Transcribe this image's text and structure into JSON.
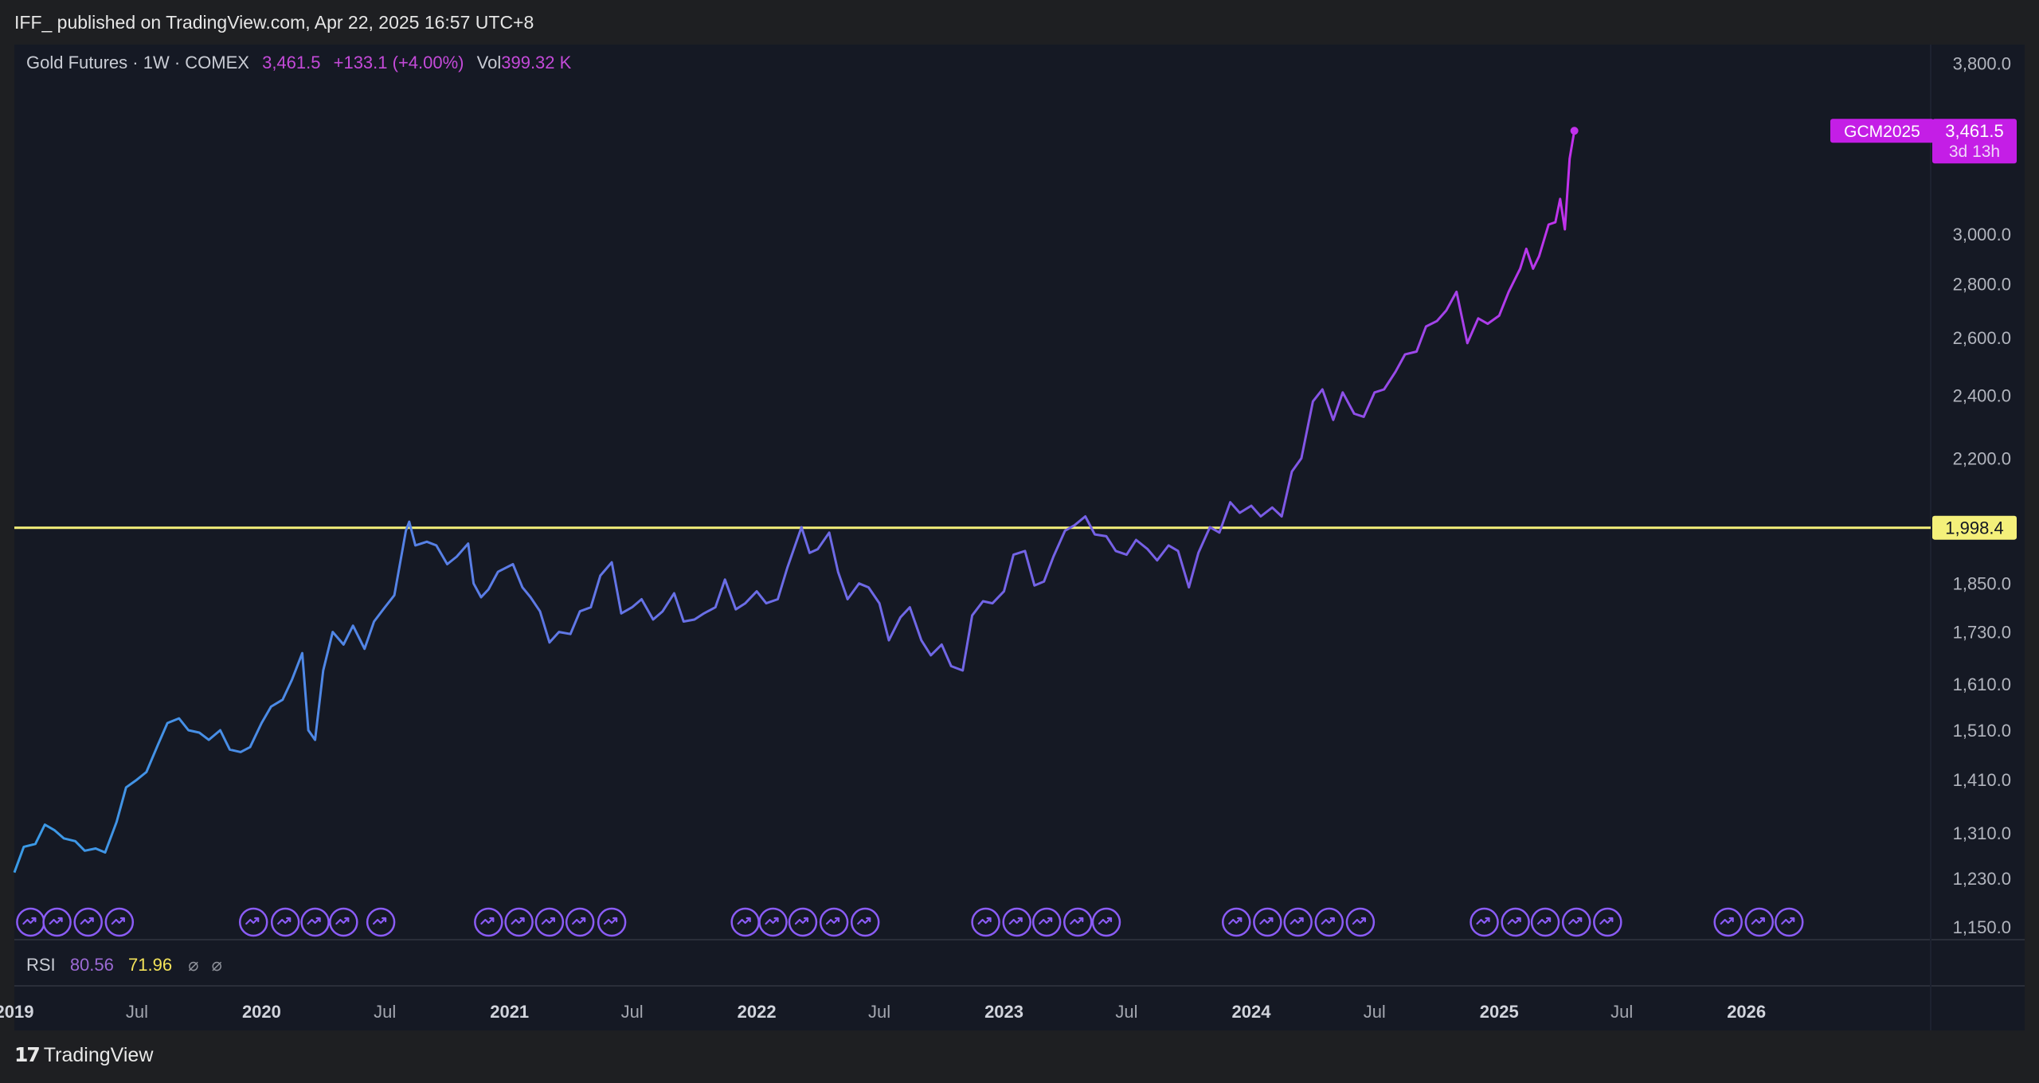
{
  "header": {
    "published": "IFF_ published on TradingView.com, Apr 22, 2025 16:57 UTC+8"
  },
  "legend": {
    "symbol": "Gold Futures · 1W · COMEX",
    "price": "3,461.5",
    "change": "+133.1 (+4.00%)",
    "vol_label": "Vol",
    "vol_value": "399.32 K"
  },
  "rsi": {
    "label": "RSI",
    "value1": "80.56",
    "value2": "71.96",
    "icon1": "⌀",
    "icon2": "⌀"
  },
  "footer": {
    "brand": "TradingView",
    "logo": "𝟭𝟳"
  },
  "colors": {
    "background": "#151924",
    "line_start": "#3a9be6",
    "line_mid": "#6a6ee6",
    "line_end": "#c231ec",
    "resistance": "#f4f07a",
    "price_badge": "#c41ee6",
    "event_icon": "#8b5cf6"
  },
  "chart_data": {
    "type": "line",
    "title": "Gold Futures · 1W · COMEX",
    "scale": "log",
    "ylim": [
      1130,
      3900
    ],
    "y_ticks": [
      3800,
      3000,
      2800,
      2600,
      2400,
      2200,
      1850,
      1730,
      1610,
      1510,
      1410,
      1310,
      1230,
      1150
    ],
    "y_tick_labels": [
      "3,800.0",
      "3,000.0",
      "2,800.0",
      "2,600.0",
      "2,400.0",
      "2,200.0",
      "1,850.0",
      "1,730.0",
      "1,610.0",
      "1,510.0",
      "1,410.0",
      "1,310.0",
      "1,230.0",
      "1,150.0"
    ],
    "x_range": [
      "2019-01-01",
      "2026-09-30"
    ],
    "x_ticks": [
      {
        "date": "2019-01-01",
        "label": "2019",
        "major": true
      },
      {
        "date": "2019-07-01",
        "label": "Jul",
        "major": false
      },
      {
        "date": "2020-01-01",
        "label": "2020",
        "major": true
      },
      {
        "date": "2020-07-01",
        "label": "Jul",
        "major": false
      },
      {
        "date": "2021-01-01",
        "label": "2021",
        "major": true
      },
      {
        "date": "2021-07-01",
        "label": "Jul",
        "major": false
      },
      {
        "date": "2022-01-01",
        "label": "2022",
        "major": true
      },
      {
        "date": "2022-07-01",
        "label": "Jul",
        "major": false
      },
      {
        "date": "2023-01-01",
        "label": "2023",
        "major": true
      },
      {
        "date": "2023-07-01",
        "label": "Jul",
        "major": false
      },
      {
        "date": "2024-01-01",
        "label": "2024",
        "major": true
      },
      {
        "date": "2024-07-01",
        "label": "Jul",
        "major": false
      },
      {
        "date": "2025-01-01",
        "label": "2025",
        "major": true
      },
      {
        "date": "2025-07-01",
        "label": "Jul",
        "major": false
      },
      {
        "date": "2026-01-01",
        "label": "2026",
        "major": true
      }
    ],
    "series": [
      {
        "name": "GCM2025",
        "points": [
          [
            "2019-01-01",
            1240
          ],
          [
            "2019-01-15",
            1285
          ],
          [
            "2019-02-01",
            1290
          ],
          [
            "2019-02-15",
            1325
          ],
          [
            "2019-03-01",
            1315
          ],
          [
            "2019-03-15",
            1300
          ],
          [
            "2019-04-01",
            1295
          ],
          [
            "2019-04-15",
            1278
          ],
          [
            "2019-05-01",
            1282
          ],
          [
            "2019-05-15",
            1275
          ],
          [
            "2019-06-01",
            1330
          ],
          [
            "2019-06-15",
            1395
          ],
          [
            "2019-07-01",
            1410
          ],
          [
            "2019-07-15",
            1425
          ],
          [
            "2019-08-01",
            1480
          ],
          [
            "2019-08-15",
            1525
          ],
          [
            "2019-09-01",
            1535
          ],
          [
            "2019-09-15",
            1510
          ],
          [
            "2019-10-01",
            1505
          ],
          [
            "2019-10-15",
            1490
          ],
          [
            "2019-11-01",
            1510
          ],
          [
            "2019-11-15",
            1470
          ],
          [
            "2019-12-01",
            1465
          ],
          [
            "2019-12-15",
            1475
          ],
          [
            "2020-01-01",
            1525
          ],
          [
            "2020-01-15",
            1560
          ],
          [
            "2020-02-01",
            1575
          ],
          [
            "2020-02-15",
            1620
          ],
          [
            "2020-03-01",
            1680
          ],
          [
            "2020-03-10",
            1510
          ],
          [
            "2020-03-20",
            1490
          ],
          [
            "2020-04-01",
            1640
          ],
          [
            "2020-04-15",
            1730
          ],
          [
            "2020-05-01",
            1700
          ],
          [
            "2020-05-15",
            1745
          ],
          [
            "2020-06-01",
            1690
          ],
          [
            "2020-06-15",
            1755
          ],
          [
            "2020-07-01",
            1790
          ],
          [
            "2020-07-15",
            1820
          ],
          [
            "2020-08-01",
            1990
          ],
          [
            "2020-08-06",
            2015
          ],
          [
            "2020-08-15",
            1950
          ],
          [
            "2020-09-01",
            1960
          ],
          [
            "2020-09-15",
            1950
          ],
          [
            "2020-10-01",
            1900
          ],
          [
            "2020-10-15",
            1920
          ],
          [
            "2020-11-01",
            1955
          ],
          [
            "2020-11-09",
            1850
          ],
          [
            "2020-11-20",
            1815
          ],
          [
            "2020-12-01",
            1835
          ],
          [
            "2020-12-15",
            1880
          ],
          [
            "2021-01-06",
            1900
          ],
          [
            "2021-01-20",
            1840
          ],
          [
            "2021-02-01",
            1815
          ],
          [
            "2021-02-15",
            1780
          ],
          [
            "2021-03-01",
            1705
          ],
          [
            "2021-03-15",
            1730
          ],
          [
            "2021-04-01",
            1725
          ],
          [
            "2021-04-15",
            1780
          ],
          [
            "2021-05-01",
            1790
          ],
          [
            "2021-05-15",
            1870
          ],
          [
            "2021-06-01",
            1905
          ],
          [
            "2021-06-15",
            1775
          ],
          [
            "2021-07-01",
            1790
          ],
          [
            "2021-07-15",
            1810
          ],
          [
            "2021-08-01",
            1760
          ],
          [
            "2021-08-15",
            1780
          ],
          [
            "2021-09-01",
            1825
          ],
          [
            "2021-09-15",
            1755
          ],
          [
            "2021-10-01",
            1760
          ],
          [
            "2021-10-15",
            1775
          ],
          [
            "2021-11-01",
            1790
          ],
          [
            "2021-11-15",
            1860
          ],
          [
            "2021-12-01",
            1785
          ],
          [
            "2021-12-15",
            1800
          ],
          [
            "2022-01-01",
            1830
          ],
          [
            "2022-01-15",
            1800
          ],
          [
            "2022-02-01",
            1810
          ],
          [
            "2022-02-15",
            1890
          ],
          [
            "2022-03-08",
            2000
          ],
          [
            "2022-03-20",
            1930
          ],
          [
            "2022-04-01",
            1940
          ],
          [
            "2022-04-18",
            1985
          ],
          [
            "2022-05-01",
            1880
          ],
          [
            "2022-05-15",
            1810
          ],
          [
            "2022-06-01",
            1850
          ],
          [
            "2022-06-15",
            1840
          ],
          [
            "2022-07-01",
            1800
          ],
          [
            "2022-07-15",
            1710
          ],
          [
            "2022-08-01",
            1765
          ],
          [
            "2022-08-15",
            1790
          ],
          [
            "2022-09-01",
            1710
          ],
          [
            "2022-09-15",
            1675
          ],
          [
            "2022-10-01",
            1700
          ],
          [
            "2022-10-15",
            1650
          ],
          [
            "2022-11-01",
            1640
          ],
          [
            "2022-11-15",
            1770
          ],
          [
            "2022-12-01",
            1805
          ],
          [
            "2022-12-15",
            1800
          ],
          [
            "2023-01-01",
            1830
          ],
          [
            "2023-01-15",
            1925
          ],
          [
            "2023-02-01",
            1935
          ],
          [
            "2023-02-15",
            1845
          ],
          [
            "2023-03-01",
            1855
          ],
          [
            "2023-03-15",
            1920
          ],
          [
            "2023-04-01",
            1990
          ],
          [
            "2023-04-15",
            2005
          ],
          [
            "2023-05-01",
            2030
          ],
          [
            "2023-05-15",
            1980
          ],
          [
            "2023-06-01",
            1975
          ],
          [
            "2023-06-15",
            1935
          ],
          [
            "2023-07-01",
            1925
          ],
          [
            "2023-07-15",
            1965
          ],
          [
            "2023-08-01",
            1940
          ],
          [
            "2023-08-15",
            1910
          ],
          [
            "2023-09-01",
            1950
          ],
          [
            "2023-09-15",
            1935
          ],
          [
            "2023-10-01",
            1840
          ],
          [
            "2023-10-15",
            1930
          ],
          [
            "2023-11-01",
            2000
          ],
          [
            "2023-11-15",
            1985
          ],
          [
            "2023-12-01",
            2070
          ],
          [
            "2023-12-15",
            2040
          ],
          [
            "2024-01-01",
            2060
          ],
          [
            "2024-01-15",
            2030
          ],
          [
            "2024-02-01",
            2055
          ],
          [
            "2024-02-15",
            2030
          ],
          [
            "2024-03-01",
            2160
          ],
          [
            "2024-03-15",
            2200
          ],
          [
            "2024-04-01",
            2380
          ],
          [
            "2024-04-15",
            2420
          ],
          [
            "2024-05-01",
            2320
          ],
          [
            "2024-05-15",
            2410
          ],
          [
            "2024-06-01",
            2340
          ],
          [
            "2024-06-15",
            2330
          ],
          [
            "2024-07-01",
            2410
          ],
          [
            "2024-07-15",
            2420
          ],
          [
            "2024-08-01",
            2480
          ],
          [
            "2024-08-15",
            2540
          ],
          [
            "2024-09-01",
            2550
          ],
          [
            "2024-09-15",
            2640
          ],
          [
            "2024-10-01",
            2660
          ],
          [
            "2024-10-15",
            2700
          ],
          [
            "2024-10-30",
            2770
          ],
          [
            "2024-11-15",
            2580
          ],
          [
            "2024-12-01",
            2670
          ],
          [
            "2024-12-15",
            2650
          ],
          [
            "2025-01-01",
            2680
          ],
          [
            "2025-01-15",
            2770
          ],
          [
            "2025-02-01",
            2860
          ],
          [
            "2025-02-10",
            2940
          ],
          [
            "2025-02-20",
            2860
          ],
          [
            "2025-03-01",
            2910
          ],
          [
            "2025-03-15",
            3040
          ],
          [
            "2025-03-25",
            3050
          ],
          [
            "2025-04-01",
            3150
          ],
          [
            "2025-04-08",
            3020
          ],
          [
            "2025-04-15",
            3330
          ],
          [
            "2025-04-22",
            3461.5
          ]
        ]
      }
    ],
    "reference_line": {
      "value": 1998.4,
      "label": "1,998.4"
    },
    "last_value": {
      "value": 3461.5,
      "label": "3,461.5",
      "countdown": "3d 13h",
      "symbol": "GCM2025"
    },
    "event_markers": [
      "2019-01-25",
      "2019-03-05",
      "2019-04-20",
      "2019-06-05",
      "2019-12-20",
      "2020-02-05",
      "2020-03-20",
      "2020-05-01",
      "2020-06-25",
      "2020-12-01",
      "2021-01-15",
      "2021-03-01",
      "2021-04-15",
      "2021-06-01",
      "2021-12-15",
      "2022-01-25",
      "2022-03-10",
      "2022-04-25",
      "2022-06-10",
      "2022-12-05",
      "2023-01-20",
      "2023-03-05",
      "2023-04-20",
      "2023-06-01",
      "2023-12-10",
      "2024-01-25",
      "2024-03-10",
      "2024-04-25",
      "2024-06-10",
      "2024-12-10",
      "2025-01-25",
      "2025-03-10",
      "2025-04-25",
      "2025-06-10",
      "2025-12-05",
      "2026-01-20",
      "2026-03-05"
    ]
  }
}
